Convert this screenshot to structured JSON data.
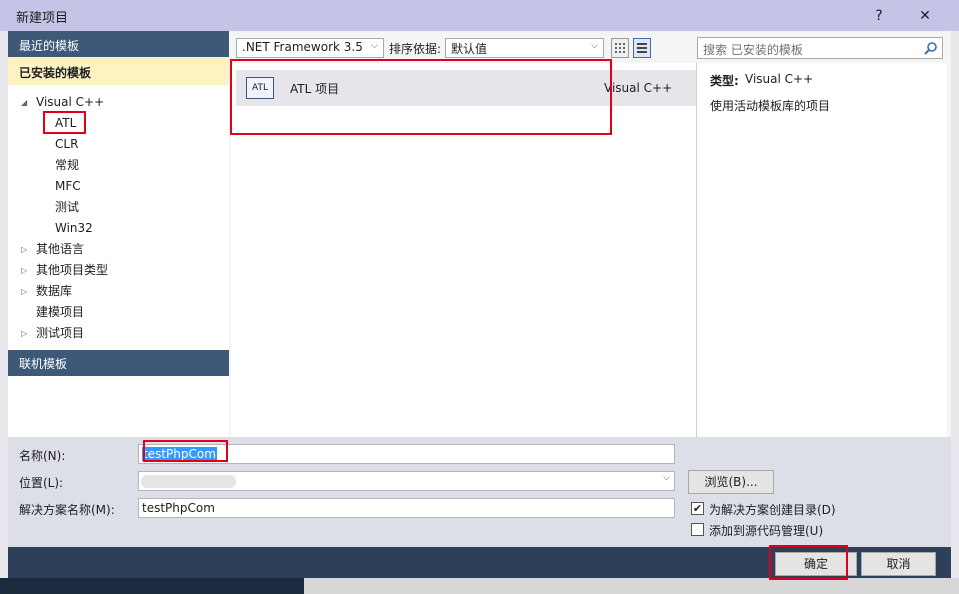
{
  "window": {
    "title": "新建项目",
    "help_label": "?",
    "close_label": "✕"
  },
  "left": {
    "recent_header": "最近的模板",
    "installed_header": "已安装的模板",
    "tree": [
      {
        "label": "Visual C++",
        "expanded": true
      },
      {
        "label": "ATL"
      },
      {
        "label": "CLR"
      },
      {
        "label": "常规"
      },
      {
        "label": "MFC"
      },
      {
        "label": "测试"
      },
      {
        "label": "Win32"
      },
      {
        "label": "其他语言"
      },
      {
        "label": "其他项目类型"
      },
      {
        "label": "数据库"
      },
      {
        "label": "建模项目"
      },
      {
        "label": "测试项目"
      }
    ],
    "online_header": "联机模板"
  },
  "toolbar": {
    "framework": ".NET Framework 3.5",
    "sort_label": "排序依据:",
    "sort_value": "默认值",
    "search_placeholder": "搜索 已安装的模板"
  },
  "templates": [
    {
      "icon_text": "ATL",
      "name": "ATL 项目",
      "language": "Visual C++"
    }
  ],
  "details": {
    "type_label": "类型:",
    "type_value": "Visual C++",
    "description": "使用活动模板库的项目"
  },
  "form": {
    "name_label": "名称(N):",
    "name_value": "testPhpCom",
    "location_label": "位置(L):",
    "location_value": "",
    "browse_label": "浏览(B)...",
    "solution_label": "解决方案名称(M):",
    "solution_value": "testPhpCom",
    "create_dir_label": "为解决方案创建目录(D)",
    "create_dir_checked": true,
    "source_control_label": "添加到源代码管理(U)",
    "source_control_checked": false
  },
  "buttons": {
    "ok": "确定",
    "cancel": "取消"
  }
}
